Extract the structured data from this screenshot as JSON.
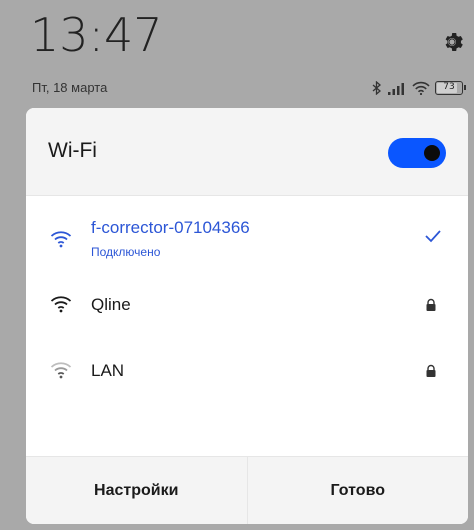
{
  "status": {
    "time": "13:47",
    "date": "Пт, 18 марта",
    "battery": "73"
  },
  "wifi_panel": {
    "title": "Wi-Fi",
    "toggle_on": true,
    "accent_color": "#0a56ff",
    "networks": [
      {
        "name": "f-corrector-07104366",
        "status": "Подключено",
        "connected": true,
        "icon": "wifi-icon",
        "right_icon": "check-icon"
      },
      {
        "name": "Qline",
        "connected": false,
        "icon": "wifi-icon",
        "right_icon": "lock-icon"
      },
      {
        "name": "LAN",
        "connected": false,
        "icon": "wifi-weak-icon",
        "right_icon": "lock-icon"
      }
    ],
    "footer": {
      "settings_label": "Настройки",
      "done_label": "Готово"
    }
  }
}
